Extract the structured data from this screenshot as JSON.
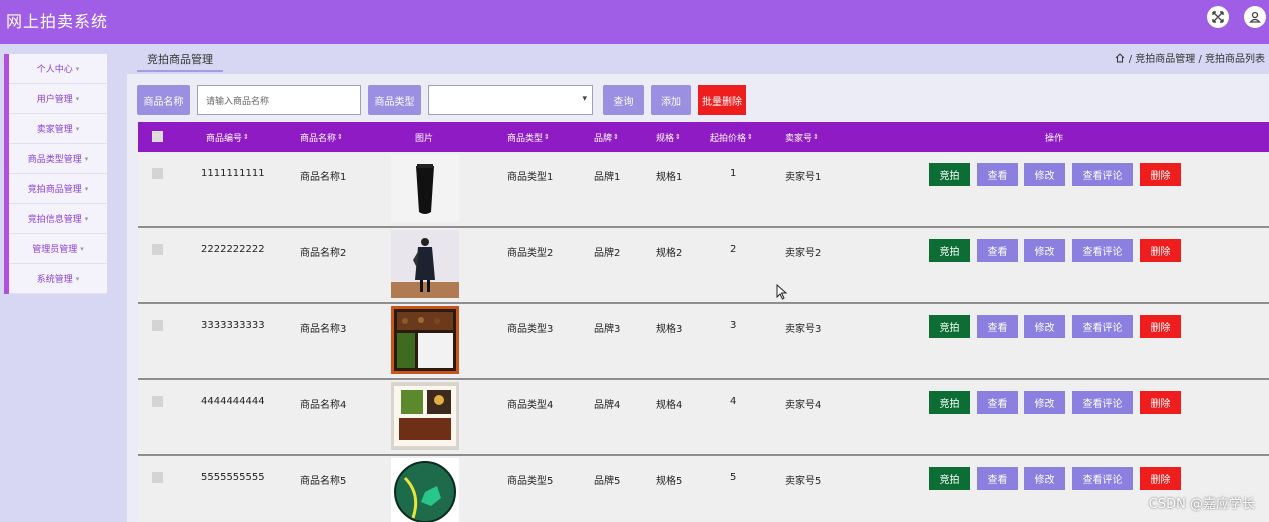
{
  "app": {
    "title": "网上拍卖系统"
  },
  "header": {
    "icons": [
      "expand-icon",
      "user-icon"
    ]
  },
  "sidebar": {
    "items": [
      {
        "label": "个人中心"
      },
      {
        "label": "用户管理"
      },
      {
        "label": "卖家管理"
      },
      {
        "label": "商品类型管理"
      },
      {
        "label": "竞拍商品管理"
      },
      {
        "label": "竞拍信息管理"
      },
      {
        "label": "管理员管理"
      },
      {
        "label": "系统管理"
      }
    ]
  },
  "page": {
    "tab": "竞拍商品管理",
    "breadcrumb": "/ 竞拍商品管理 / 竞拍商品列表"
  },
  "search": {
    "name_label": "商品名称",
    "name_placeholder": "请输入商品名称",
    "type_label": "商品类型",
    "type_value": "",
    "query": "查询",
    "add": "添加",
    "batch_delete": "批量删除"
  },
  "table": {
    "headers": {
      "code": "商品编号",
      "name": "商品名称",
      "image": "图片",
      "type": "商品类型",
      "brand": "品牌",
      "spec": "规格",
      "price": "起拍价格",
      "seller": "卖家号",
      "ops": "操作"
    },
    "actions": {
      "auction": "竞拍",
      "view": "查看",
      "edit": "修改",
      "review": "查看评论",
      "delete": "删除"
    },
    "rows": [
      {
        "code": "1111111111",
        "name": "商品名称1",
        "type": "商品类型1",
        "brand": "品牌1",
        "spec": "规格1",
        "price": "1",
        "seller": "卖家号1",
        "image": "black-tube-product-image"
      },
      {
        "code": "2222222222",
        "name": "商品名称2",
        "type": "商品类型2",
        "brand": "品牌2",
        "spec": "规格2",
        "price": "2",
        "seller": "卖家号2",
        "image": "fashion-model-image"
      },
      {
        "code": "3333333333",
        "name": "商品名称3",
        "type": "商品类型3",
        "brand": "品牌3",
        "spec": "规格3",
        "price": "3",
        "seller": "卖家号3",
        "image": "bento-box-image"
      },
      {
        "code": "4444444444",
        "name": "商品名称4",
        "type": "商品类型4",
        "brand": "品牌4",
        "spec": "规格4",
        "price": "4",
        "seller": "卖家号4",
        "image": "meal-tray-image"
      },
      {
        "code": "5555555555",
        "name": "商品名称5",
        "type": "商品类型5",
        "brand": "品牌5",
        "spec": "规格5",
        "price": "5",
        "seller": "卖家号5",
        "image": "soccer-ball-image"
      }
    ]
  },
  "watermark": "CSDN @嘉应学长",
  "colors": {
    "header": "#a05ee6",
    "table_head": "#8f1bc4",
    "accent_button": "#9a8fe0",
    "danger": "#ee1e1e",
    "auction": "#0d6e35"
  }
}
